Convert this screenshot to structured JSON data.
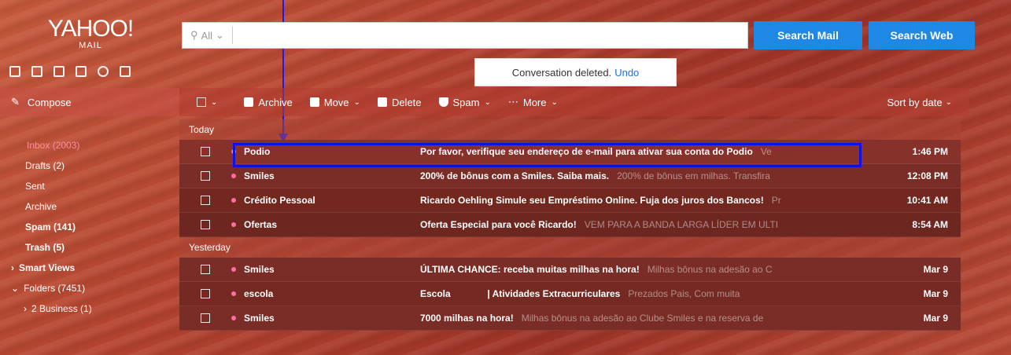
{
  "logo": {
    "main": "YAHOO!",
    "sub": "MAIL"
  },
  "app_icons": [
    "mail-icon",
    "contacts-icon",
    "calendar-icon",
    "notepad-icon",
    "messenger-icon",
    "newsfeed-icon"
  ],
  "search": {
    "scope": "All",
    "value": "",
    "placeholder": ""
  },
  "buttons": {
    "search_mail": "Search Mail",
    "search_web": "Search Web"
  },
  "toast": {
    "message": "Conversation deleted.",
    "undo": "Undo"
  },
  "compose": "Compose",
  "sidebar": {
    "items": [
      {
        "label": "Inbox (2003)"
      },
      {
        "label": "Drafts (2)"
      },
      {
        "label": "Sent"
      },
      {
        "label": "Archive"
      },
      {
        "label": "Spam (141)"
      },
      {
        "label": "Trash (5)"
      },
      {
        "label": "Smart Views"
      },
      {
        "label": "Folders (7451)"
      },
      {
        "label": "2 Business (1)"
      }
    ]
  },
  "toolbar": {
    "archive": "Archive",
    "move": "Move",
    "delete": "Delete",
    "spam": "Spam",
    "more": "More",
    "sort": "Sort by date"
  },
  "sections": {
    "today": "Today",
    "yesterday": "Yesterday"
  },
  "emails": [
    {
      "sender": "Podio",
      "subject": "Por favor, verifique seu endereço de e-mail para ativar sua conta do Podio",
      "preview": "Ve",
      "time": "1:46 PM"
    },
    {
      "sender": "Smiles",
      "subject": "200% de bônus com a Smiles. Saiba mais.",
      "preview": "200% de bônus em milhas. Transfira",
      "time": "12:08 PM"
    },
    {
      "sender": "Crédito Pessoal",
      "subject": "Ricardo Oehling Simule seu Empréstimo Online. Fuja dos juros dos Bancos!",
      "preview": "Pr",
      "time": "10:41 AM"
    },
    {
      "sender": "Ofertas",
      "subject": "Oferta Especial para você Ricardo!",
      "preview": "VEM PARA A BANDA LARGA LÍDER EM ULTI",
      "time": "8:54 AM"
    },
    {
      "sender": "Smiles",
      "subject": "ÚLTIMA CHANCE: receba muitas milhas na hora!",
      "preview": "Milhas bônus na adesão ao C",
      "time": "Mar 9"
    },
    {
      "sender": "escola",
      "subject": "Escola              | Atividades Extracurriculares",
      "preview": "Prezados Pais, Com muita",
      "time": "Mar 9"
    },
    {
      "sender": "Smiles",
      "subject": "7000 milhas na hora!",
      "preview": "Milhas bônus na adesão ao Clube Smiles e na reserva de",
      "time": "Mar 9"
    }
  ],
  "colors": {
    "accent": "#1e88e5",
    "highlight": "#0a12e8",
    "unread_dot": "#ff6ea0"
  }
}
